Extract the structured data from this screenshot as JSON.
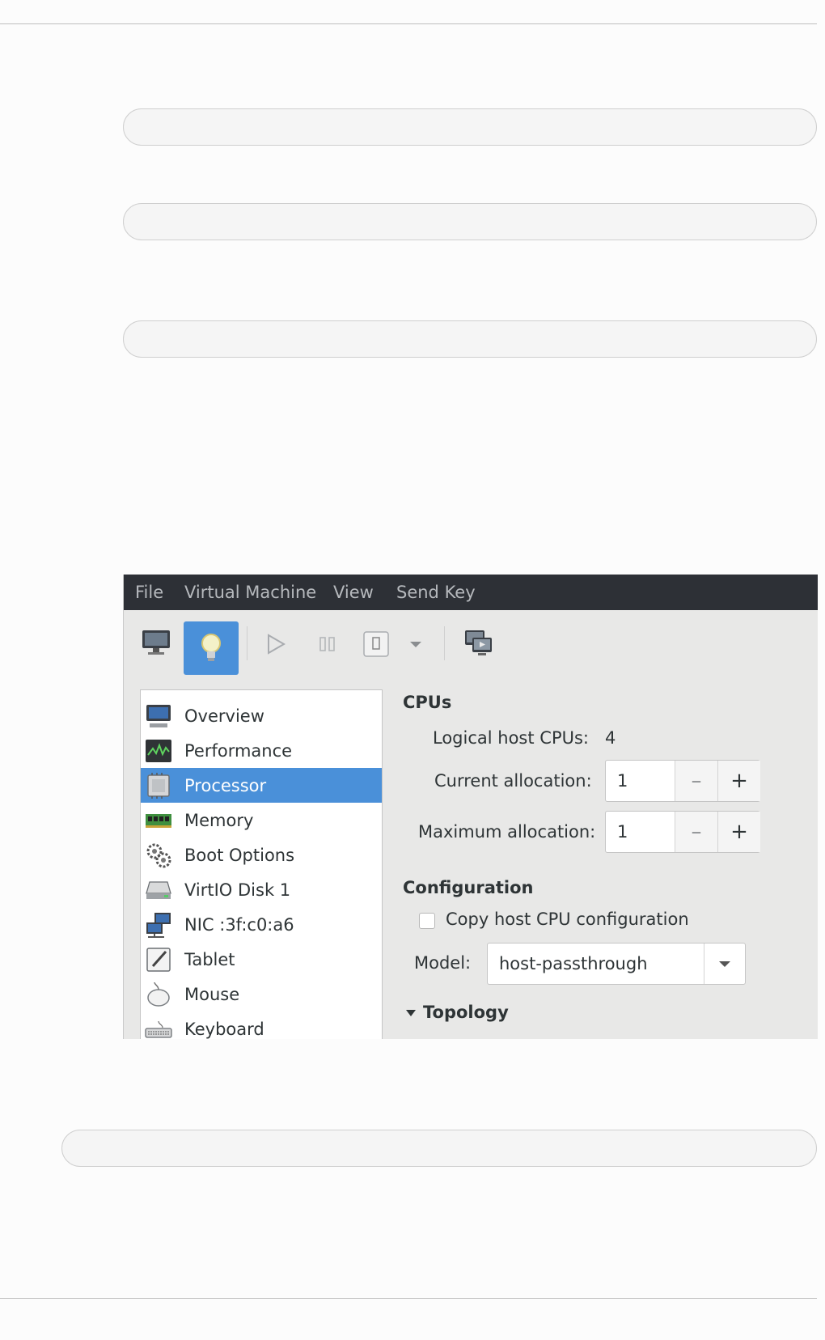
{
  "menubar": {
    "items": [
      "File",
      "Virtual Machine",
      "View",
      "Send Key"
    ]
  },
  "toolbar": {
    "buttons": [
      "monitor-icon",
      "lightbulb-icon",
      "play-icon",
      "pause-icon",
      "power-icon",
      "chevron-down-icon",
      "screens-icon"
    ],
    "active": "lightbulb-icon"
  },
  "sidebar": {
    "items": [
      {
        "label": "Overview",
        "icon": "overview-monitor-icon"
      },
      {
        "label": "Performance",
        "icon": "performance-graph-icon"
      },
      {
        "label": "Processor",
        "icon": "processor-chip-icon"
      },
      {
        "label": "Memory",
        "icon": "memory-module-icon"
      },
      {
        "label": "Boot Options",
        "icon": "gears-icon"
      },
      {
        "label": "VirtIO Disk 1",
        "icon": "disk-icon"
      },
      {
        "label": "NIC :3f:c0:a6",
        "icon": "network-icon"
      },
      {
        "label": "Tablet",
        "icon": "tablet-icon"
      },
      {
        "label": "Mouse",
        "icon": "mouse-icon"
      },
      {
        "label": "Keyboard",
        "icon": "keyboard-icon"
      }
    ],
    "selected": "Processor"
  },
  "cpus": {
    "heading": "CPUs",
    "logical_label": "Logical host CPUs:",
    "logical_value": "4",
    "current_label": "Current allocation:",
    "current_value": "1",
    "maximum_label": "Maximum allocation:",
    "maximum_value": "1",
    "minus": "–",
    "plus": "+"
  },
  "configuration": {
    "heading": "Configuration",
    "copy_label": "Copy host CPU configuration",
    "copy_checked": false,
    "model_label": "Model:",
    "model_value": "host-passthrough"
  },
  "topology": {
    "heading": "Topology",
    "expanded": true
  },
  "colors": {
    "accent": "#4a90d9",
    "menubar": "#2d3036"
  }
}
